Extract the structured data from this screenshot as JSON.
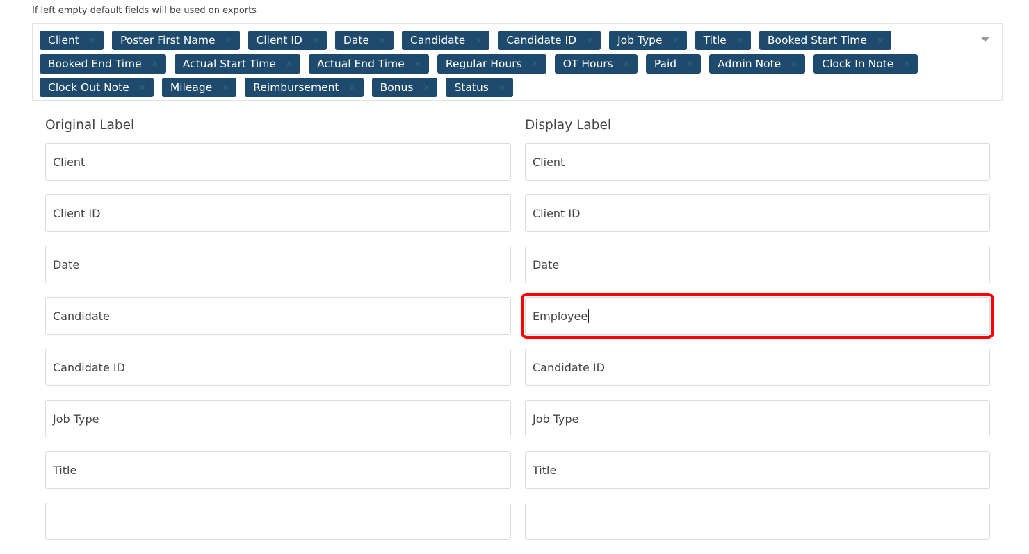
{
  "hint": "If left empty default fields will be used on exports",
  "tags": [
    "Client",
    "Poster First Name",
    "Client ID",
    "Date",
    "Candidate",
    "Candidate ID",
    "Job Type",
    "Title",
    "Booked Start Time",
    "Booked End Time",
    "Actual Start Time",
    "Actual End Time",
    "Regular Hours",
    "OT Hours",
    "Paid",
    "Admin Note",
    "Clock In Note",
    "Clock Out Note",
    "Mileage",
    "Reimbursement",
    "Bonus",
    "Status"
  ],
  "remove_glyph": "×",
  "headers": {
    "original": "Original Label",
    "display": "Display Label"
  },
  "rows": [
    {
      "original": "Client",
      "display": "Client"
    },
    {
      "original": "Client ID",
      "display": "Client ID"
    },
    {
      "original": "Date",
      "display": "Date"
    },
    {
      "original": "Candidate",
      "display": "Employee"
    },
    {
      "original": "Candidate ID",
      "display": "Candidate ID"
    },
    {
      "original": "Job Type",
      "display": "Job Type"
    },
    {
      "original": "Title",
      "display": "Title"
    },
    {
      "original": "",
      "display": ""
    }
  ],
  "colors": {
    "tag_bg": "#1e4a6e",
    "highlight": "#ff0000"
  }
}
